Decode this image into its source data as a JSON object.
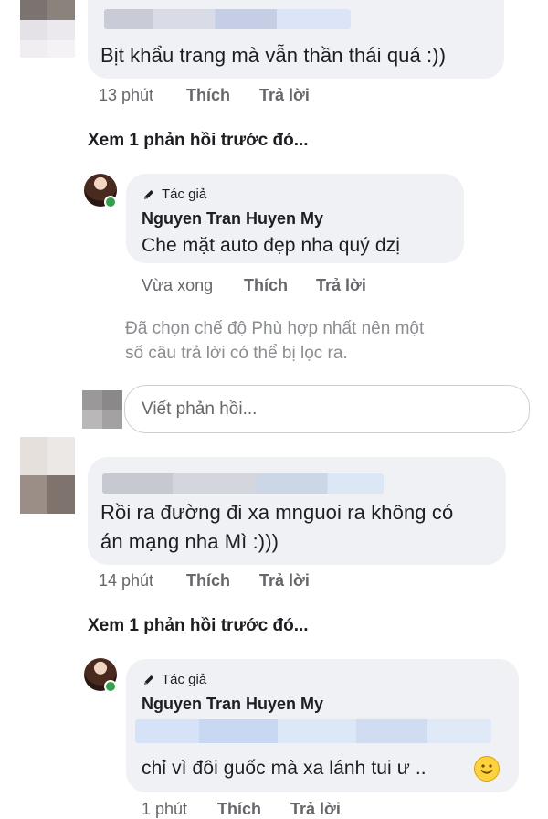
{
  "comments": [
    {
      "text": "Bịt khẩu trang mà vẫn thần thái quá :))",
      "time": "13 phút",
      "like": "Thích",
      "reply": "Trả lời",
      "view_more": "Xem 1 phản hồi trước đó..."
    },
    {
      "text_line1": "Rồi ra đường đi xa mnguoi ra không có",
      "text_line2": "án mạng nha Mì :)))",
      "time": "14 phút",
      "like": "Thích",
      "reply": "Trả lời",
      "view_more": "Xem 1 phản hồi trước đó..."
    }
  ],
  "replies": [
    {
      "tag": "Tác giả",
      "author": "Nguyen Tran Huyen My",
      "text": "Che mặt auto đẹp nha quý dzị",
      "time": "Vừa xong",
      "like": "Thích",
      "reply": "Trả lời"
    },
    {
      "tag": "Tác giả",
      "author": "Nguyen Tran Huyen My",
      "text": "chỉ vì đôi guốc mà xa lánh tui ư ..",
      "time": "1 phút",
      "like": "Thích",
      "reply": "Trả lời"
    }
  ],
  "filter_note_line1": "Đã chọn chế độ Phù hợp nhất nên một",
  "filter_note_line2": "số câu trả lời có thể bị lọc ra.",
  "reply_input_placeholder": "Viết phản hồi...",
  "icons": {
    "author_tag": "pencil-icon",
    "emoji": "smile-emoji-icon"
  },
  "colors": {
    "bubble": "#eff1f4",
    "meta": "#65676b",
    "online": "#31a24c"
  }
}
